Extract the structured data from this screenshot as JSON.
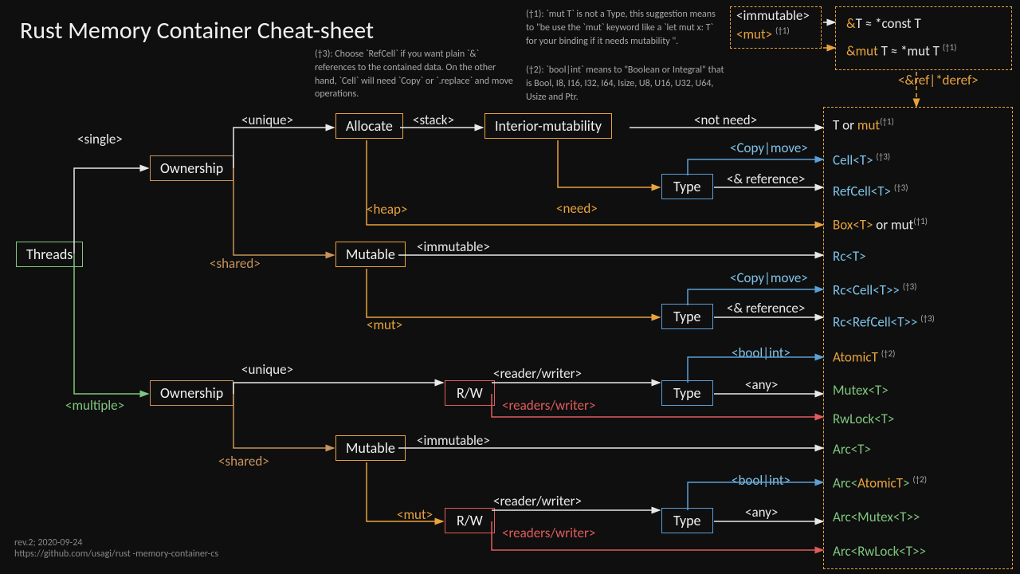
{
  "title": "Rust Memory Container Cheat-sheet",
  "notes": {
    "t3": "(†3): Choose `RefCell` if you want plain `&` references to the contained data. On the other hand, `Cell` will need `Copy` or `.replace` and move operations.",
    "t1": "(†1): `mut T` is not a Type, this suggestion means to \"be use the `mut` keyword like a `let mut x: T` for your binding if it needs mutability \".",
    "t2": "(†2): `bool|int` means to \"Boolean or Integral\" that is Bool, I8, I16, I32, I64, Isize, U8, U16, U32, U64,  Usize and Ptr."
  },
  "nodes": {
    "threads": "Threads",
    "ownership": "Ownership",
    "allocate": "Allocate",
    "interior": "Interior-mutability",
    "type": "Type",
    "mutable": "Mutable",
    "rw": "R/W"
  },
  "labels": {
    "single": "<single>",
    "multiple": "<multiple>",
    "unique": "<unique>",
    "shared": "<shared>",
    "stack": "<stack>",
    "heap": "<heap>",
    "notneed": "<not need>",
    "need": "<need>",
    "copymove": "<Copy|move>",
    "ref": "<& reference>",
    "immutable": "<immutable>",
    "mut": "<mut>",
    "boolint": "<bool|int>",
    "any": "<any>",
    "readerwriter": "<reader/writer>",
    "readerswriter": "<readers/writer>",
    "refderef": "<&ref|*deref>"
  },
  "ends": {
    "tormut": "T or mut",
    "cell": "Cell<T>",
    "refcell": "RefCell<T>",
    "box": "Box<T>",
    "ormut": " or mut",
    "rc": "Rc<T>",
    "rccell": "Rc<Cell<T>>",
    "rcrefcell": "Rc<RefCell<T>>",
    "atomict": "AtomicT",
    "mutex": "Mutex<T>",
    "rwlock": "RwLock<T>",
    "arc": "Arc<T>",
    "arcatomic_a": "Arc<",
    "arcatomic_b": "AtomicT",
    "arcatomic_c": ">",
    "arcmutex": "Arc<Mutex<T>>",
    "arcrwlock": "Arc<RwLock<T>>",
    "constT_a": "&T ≈ *const T",
    "mutT_a": "&mut T ≈ *mut T",
    "mutbox": "<mut>"
  },
  "footnotes": {
    "t1": "(†1)",
    "t2": "(†2)",
    "t3": "(†3)"
  },
  "rev": {
    "line1": "rev.2; 2020-09-24",
    "line2": "https://github.com/usagi/rust -memory-container-cs"
  }
}
